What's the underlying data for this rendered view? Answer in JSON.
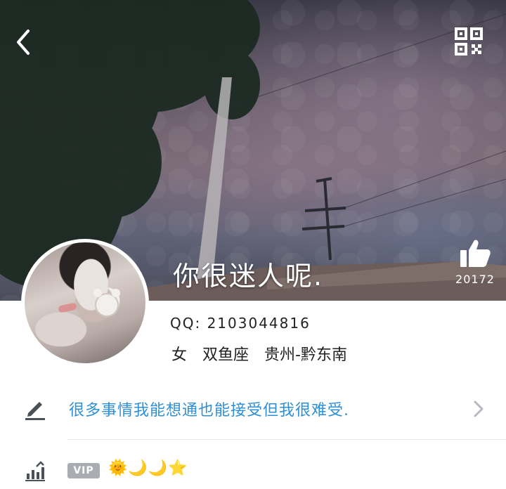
{
  "header": {
    "back_icon": "chevron-left-icon",
    "qr_icon": "qr-code-icon"
  },
  "profile": {
    "nickname": "你很迷人呢.",
    "likes_count": "20172",
    "qq_label": "QQ: 2103044816",
    "gender": "女",
    "zodiac": "双鱼座",
    "location": "贵州-黔东南"
  },
  "signature": {
    "icon": "pencil-icon",
    "text": "很多事情我能想通也能接受但我很难受."
  },
  "vip": {
    "icon": "level-chart-icon",
    "badge": "VIP",
    "level_glyphs": [
      "🌞",
      "🌙",
      "🌙",
      "⭐"
    ]
  },
  "colors": {
    "accent_blue": "#2f8fd6",
    "vip_badge_gray": "#a9adb3",
    "text_dark": "#222222"
  }
}
